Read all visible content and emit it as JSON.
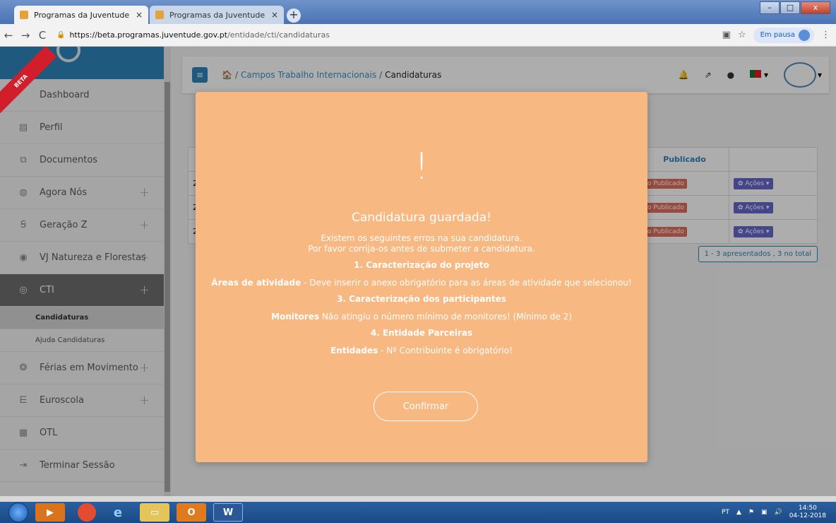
{
  "browser": {
    "tabs": [
      {
        "title": "Programas da Juventude",
        "active": true
      },
      {
        "title": "Programas da Juventude",
        "active": false
      }
    ],
    "close_glyph": "×",
    "new_tab_glyph": "+",
    "url_host": "https://beta.programas.juventude.gov.pt",
    "url_path": "/entidade/cti/candidaturas",
    "pause_label": "Em pausa",
    "window_buttons": {
      "minimize": "–",
      "maximize": "□",
      "close": "x"
    }
  },
  "sidebar": {
    "beta_label": "BETA",
    "items": [
      {
        "label": "Dashboard",
        "icon": "dashboard-icon",
        "has_plus": false
      },
      {
        "label": "Perfil",
        "icon": "id-card-icon",
        "has_plus": false
      },
      {
        "label": "Documentos",
        "icon": "documents-icon",
        "has_plus": false
      },
      {
        "label": "Agora Nós",
        "icon": "agora-nos-icon",
        "has_plus": true
      },
      {
        "label": "Geração Z",
        "icon": "geracao-z-icon",
        "has_plus": true
      },
      {
        "label": "VJ Natureza e Florestas",
        "icon": "tree-icon",
        "has_plus": true
      },
      {
        "label": "CTI",
        "icon": "globe-icon",
        "has_plus": true
      }
    ],
    "cti_sub": [
      "Candidaturas",
      "Ajuda Candidaturas"
    ],
    "items_after": [
      {
        "label": "Férias em Movimento",
        "icon": "ferias-icon",
        "has_plus": true
      },
      {
        "label": "Euroscola",
        "icon": "euroscola-icon",
        "has_plus": true
      },
      {
        "label": "OTL",
        "icon": "otl-icon",
        "has_plus": false
      },
      {
        "label": "Terminar Sessão",
        "icon": "sign-out-icon",
        "has_plus": false
      }
    ],
    "plus_glyph": "+"
  },
  "breadcrumb": {
    "home_glyph": "🏠",
    "separator": "/",
    "section": "Campos Trabalho Internacionais",
    "current": "Candidaturas"
  },
  "table": {
    "header_publicado": "Publicado",
    "rows": [
      {
        "id": "2",
        "status": "o Publicado",
        "action": "✿ Ações ▾"
      },
      {
        "id": "2",
        "status": "o Publicado",
        "action": "✿ Ações ▾"
      },
      {
        "id": "2",
        "status": "o Publicado",
        "action": "✿ Ações ▾"
      }
    ],
    "pager": "1 - 3 apresentados , 3 no total"
  },
  "modal": {
    "icon": "!",
    "title": "Candidatura guardada!",
    "intro_1": "Existem os seguintes erros na sua candidatura.",
    "intro_2": "Por favor corrija-os antes de submeter a candidatura.",
    "sections": [
      {
        "heading": "1. Caracterização do projeto",
        "field": "Áreas de atividade",
        "message": " - Deve inserir o anexo obrigatório para as áreas de atividade que selecionou!"
      },
      {
        "heading": "3. Caracterização dos participantes",
        "field": "Monitores",
        "message": " Não atingiu o número mínimo de monitores! (Mínimo de 2)"
      },
      {
        "heading": "4. Entidade Parceiras",
        "field": "Entidades",
        "message": " - Nº Contribuinte é obrigatório!"
      }
    ],
    "confirm_label": "Confirmar"
  },
  "taskbar": {
    "word_label": "W",
    "outlook_label": "O",
    "lang": "PT",
    "time": "14:50",
    "date": "04-12-2018"
  },
  "colors": {
    "modal_bg": "#f7b882",
    "brand_blue": "#2f84b9",
    "beta_red": "#d21e2a"
  }
}
